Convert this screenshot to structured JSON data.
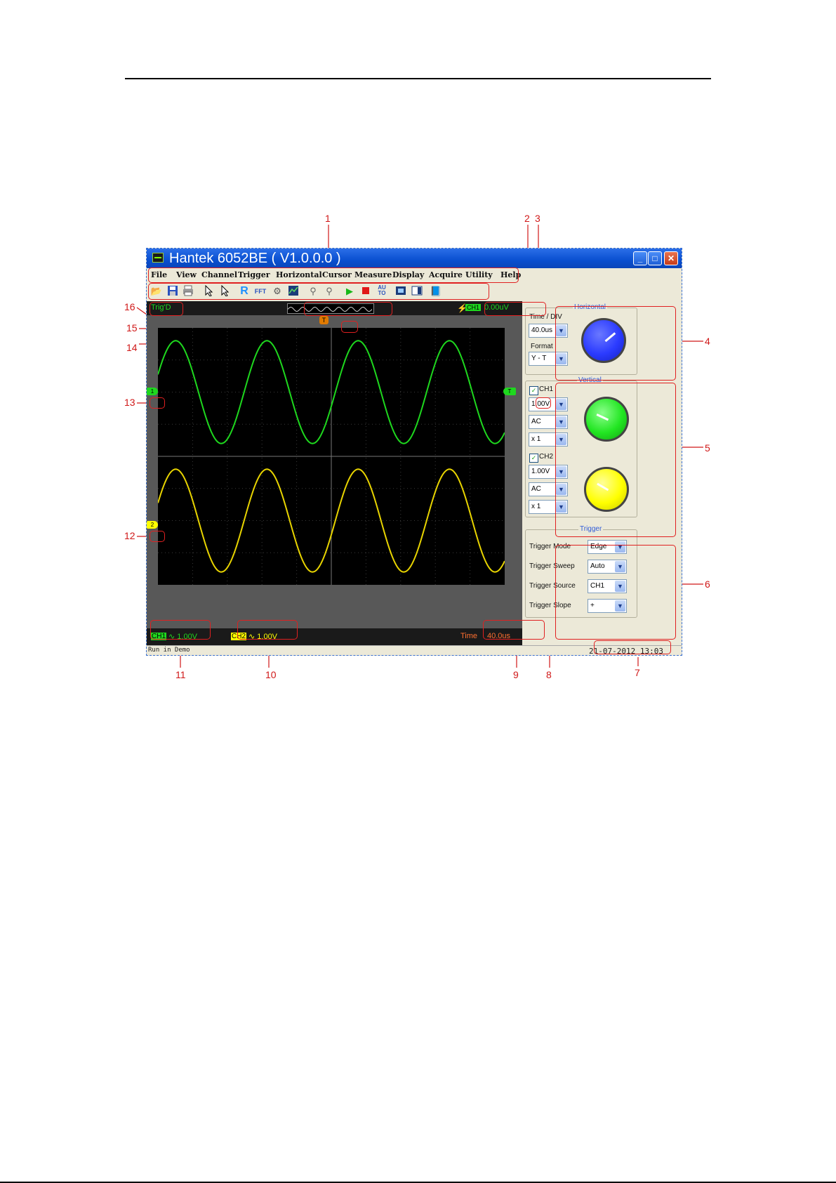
{
  "app": {
    "title": "Hantek 6052BE ( V1.0.0.0 )",
    "window_buttons": [
      "_",
      "□",
      "✕"
    ]
  },
  "menu": [
    "File",
    "View",
    "Channel",
    "Trigger",
    "Horizontal",
    "Cursor",
    "Measure",
    "Display",
    "Acquire",
    "Utility",
    "Help"
  ],
  "toolbar_icons": [
    "open-icon",
    "save-icon",
    "print-icon",
    "select-icon",
    "pointer-icon",
    "ref-icon",
    "fft-icon",
    "settings-icon",
    "chart-icon",
    "zoom-in-icon",
    "zoom-out-icon",
    "run-icon",
    "stop-icon",
    "auto-icon",
    "snapshot-icon",
    "window-icon",
    "help-book-icon"
  ],
  "toolbar_glyphs": {
    "ref": "R",
    "fft": "FFT",
    "auto_line1": "AU",
    "auto_line2": "TO"
  },
  "display": {
    "trig_status": "Trig'D",
    "trigger_channel": "CH1",
    "trigger_level": "0.00uV",
    "trigger_slope_glyph": "⚡",
    "trigger_marker": "T",
    "ch1_marker": "1",
    "ch2_marker": "2",
    "ch1_level_marker": "T"
  },
  "bottom_info": {
    "ch1_tag": "CH1",
    "ch1_value": "∿ 1.00V",
    "ch2_tag": "CH2",
    "ch2_value": "∿ 1.00V",
    "time_label": "Time",
    "time_value": "40.0us"
  },
  "horizontal": {
    "title": "Horizontal",
    "time_div_label": "Time / DIV",
    "time_div_value": "40.0us",
    "format_label": "Format",
    "format_value": "Y - T",
    "knob_color": "#2b3bff"
  },
  "vertical": {
    "title": "Vertical",
    "ch1_label": "CH1",
    "ch1_volts": "1.00V",
    "ch1_coupling": "AC",
    "ch1_probe": "x 1",
    "ch2_label": "CH2",
    "ch2_volts": "1.00V",
    "ch2_coupling": "AC",
    "ch2_probe": "x 1",
    "ch1_knob_color": "#22e622",
    "ch2_knob_color": "#ffff00"
  },
  "trigger": {
    "title": "Trigger",
    "mode_label": "Trigger Mode",
    "mode_value": "Edge",
    "sweep_label": "Trigger Sweep",
    "sweep_value": "Auto",
    "source_label": "Trigger Source",
    "source_value": "CH1",
    "slope_label": "Trigger Slope",
    "slope_value": "+"
  },
  "status": {
    "left": "Run in Demo",
    "datetime": "21-07-2012   13:03"
  },
  "callouts": [
    "1",
    "2",
    "3",
    "4",
    "5",
    "6",
    "7",
    "8",
    "9",
    "10",
    "11",
    "12",
    "13",
    "14",
    "15",
    "16"
  ],
  "footer_text": "",
  "waveforms": {
    "ch1_color": "#1ed81e",
    "ch2_color": "#e8d400",
    "cycles_visible": 3.8,
    "grid_divisions": {
      "x": 10,
      "y": 8
    }
  }
}
